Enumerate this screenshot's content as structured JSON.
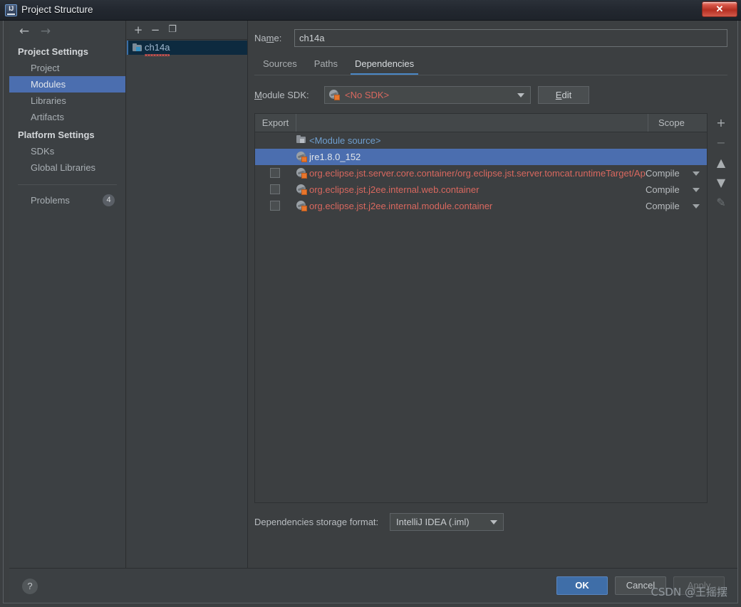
{
  "window": {
    "title": "Project Structure",
    "logo_text": "IJ",
    "close_label": "✕"
  },
  "sidebar": {
    "nav": {
      "back": "←",
      "forward": "→"
    },
    "sections": [
      {
        "title": "Project Settings",
        "items": [
          {
            "label": "Project",
            "selected": false
          },
          {
            "label": "Modules",
            "selected": true
          },
          {
            "label": "Libraries",
            "selected": false
          },
          {
            "label": "Artifacts",
            "selected": false
          }
        ]
      },
      {
        "title": "Platform Settings",
        "items": [
          {
            "label": "SDKs",
            "selected": false
          },
          {
            "label": "Global Libraries",
            "selected": false
          }
        ]
      }
    ],
    "problems": {
      "label": "Problems",
      "count": "4"
    }
  },
  "module_panel": {
    "toolbar": {
      "add": "+",
      "remove": "−",
      "copy": "❐"
    },
    "modules": [
      {
        "name": "ch14a",
        "icon": "module-folder-icon",
        "selected": true,
        "has_error": true
      }
    ]
  },
  "content": {
    "name_field": {
      "label": "Name:",
      "value": "ch14a",
      "placeholder": ""
    },
    "tabs": [
      {
        "label": "Sources",
        "active": false
      },
      {
        "label": "Paths",
        "active": false
      },
      {
        "label": "Dependencies",
        "active": true
      }
    ],
    "module_sdk": {
      "label": "Module SDK:",
      "value": "<No SDK>",
      "icon": "sdk-icon",
      "edit_label": "Edit"
    },
    "table": {
      "headers": {
        "export": "Export",
        "name": "",
        "scope": "Scope"
      },
      "rows": [
        {
          "checkbox": null,
          "icon": "folder-icon",
          "name": "<Module source>",
          "color": "blue",
          "scope": null,
          "selected": false
        },
        {
          "checkbox": null,
          "icon": "sdk-icon",
          "name": "jre1.8.0_152",
          "color": "white",
          "scope": null,
          "selected": true
        },
        {
          "checkbox": false,
          "icon": "sdk-icon",
          "name": "org.eclipse.jst.server.core.container/org.eclipse.jst.server.tomcat.runtimeTarget/Apach",
          "color": "red",
          "scope": "Compile",
          "selected": false
        },
        {
          "checkbox": false,
          "icon": "sdk-icon",
          "name": "org.eclipse.jst.j2ee.internal.web.container",
          "color": "red",
          "scope": "Compile",
          "selected": false
        },
        {
          "checkbox": false,
          "icon": "sdk-icon",
          "name": "org.eclipse.jst.j2ee.internal.module.container",
          "color": "red",
          "scope": "Compile",
          "selected": false
        }
      ]
    },
    "side_tools": [
      {
        "icon": "plus-icon",
        "label": "+",
        "dim": false
      },
      {
        "icon": "minus-icon",
        "label": "−",
        "dim": true
      },
      {
        "icon": "arrow-up-icon",
        "label": "▲",
        "dim": false
      },
      {
        "icon": "arrow-down-icon",
        "label": "▼",
        "dim": false
      },
      {
        "icon": "edit-pencil-icon",
        "label": "✎",
        "dim": true
      }
    ],
    "storage_format": {
      "label": "Dependencies storage format:",
      "value": "IntelliJ IDEA (.iml)"
    }
  },
  "footer": {
    "help": "?",
    "ok": "OK",
    "cancel": "Cancel",
    "apply": "Apply",
    "watermark": "CSDN @王摇摆"
  },
  "colors": {
    "accent_blue": "#4b6eaf",
    "tab_underline": "#4a88c7",
    "error_red": "#d9685f",
    "link_blue": "#6f9fd0",
    "badge_orange": "#e8762c"
  }
}
